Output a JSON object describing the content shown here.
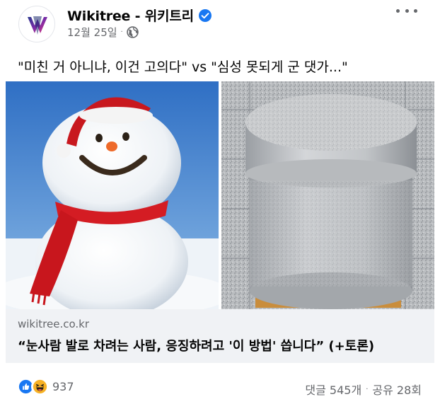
{
  "header": {
    "page_name": "Wikitree - 위키트리",
    "date": "12월 25일",
    "meta_separator": "·",
    "icons": [
      "verified-icon",
      "globe-icon",
      "more-icon"
    ]
  },
  "post": {
    "text": "\"미친 거 아니냐, 이건 고의다\" vs \"심성 못되게 군 댓가...\""
  },
  "link_preview": {
    "domain": "wikitree.co.kr",
    "title": "“눈사람 발로 차려는 사람, 응징하려고 '이 방법' 씁니다” (+토론)"
  },
  "footer": {
    "reaction_count": "937",
    "comments": "댓글 545개",
    "separator": "·",
    "shares": "공유 28회"
  },
  "colors": {
    "accent": "#1877f2",
    "muted": "#65676b",
    "preview_bg": "#f0f2f5",
    "haha": "#f7b125"
  }
}
